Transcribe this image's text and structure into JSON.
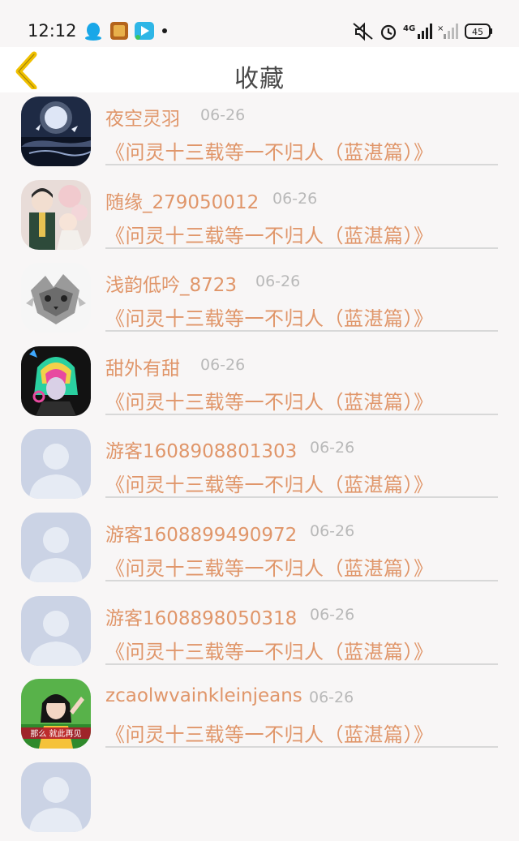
{
  "status_bar": {
    "time": "12:12",
    "network": "4G",
    "battery": "45",
    "icons": [
      "qq-icon",
      "game-app-icon",
      "video-app-icon",
      "dot-icon",
      "mute-icon",
      "alarm-icon",
      "signal-4g-icon",
      "signal-no-sim-icon",
      "battery-icon"
    ]
  },
  "header": {
    "title": "收藏",
    "back_icon": "chevron-left-icon"
  },
  "colors": {
    "accent": "#e0966a",
    "back_icon": "#f0c000",
    "date": "#b9b9b9",
    "divider": "#d8d8d8",
    "background": "#f8f6f6"
  },
  "items": [
    {
      "name": "夜空灵羽",
      "date": "06-26",
      "subject": "《问灵十三载等一不归人（蓝湛篇）》",
      "avatar": "night-sky-avatar"
    },
    {
      "name": "随缘_279050012",
      "date": "06-26",
      "subject": "《问灵十三载等一不归人（蓝湛篇）》",
      "avatar": "anime-couple-avatar"
    },
    {
      "name": "浅韵低吟_8723",
      "date": "06-26",
      "subject": "《问灵十三载等一不归人（蓝湛篇）》",
      "avatar": "wolf-avatar"
    },
    {
      "name": "甜外有甜",
      "date": "06-26",
      "subject": "《问灵十三载等一不归人（蓝湛篇）》",
      "avatar": "neon-anime-avatar"
    },
    {
      "name": "游客1608908801303",
      "date": "06-26",
      "subject": "《问灵十三载等一不归人（蓝湛篇）》",
      "avatar": "default-user-avatar"
    },
    {
      "name": "游客1608899490972",
      "date": "06-26",
      "subject": "《问灵十三载等一不归人（蓝湛篇）》",
      "avatar": "default-user-avatar"
    },
    {
      "name": "游客1608898050318",
      "date": "06-26",
      "subject": "《问灵十三载等一不归人（蓝湛篇）》",
      "avatar": "default-user-avatar"
    },
    {
      "name": "zcaolwvainkleinjeans",
      "date": "06-26",
      "subject": "《问灵十三载等一不归人（蓝湛篇）》",
      "avatar": "girl-photo-avatar",
      "avatar_caption": "那么 就此再见"
    }
  ]
}
